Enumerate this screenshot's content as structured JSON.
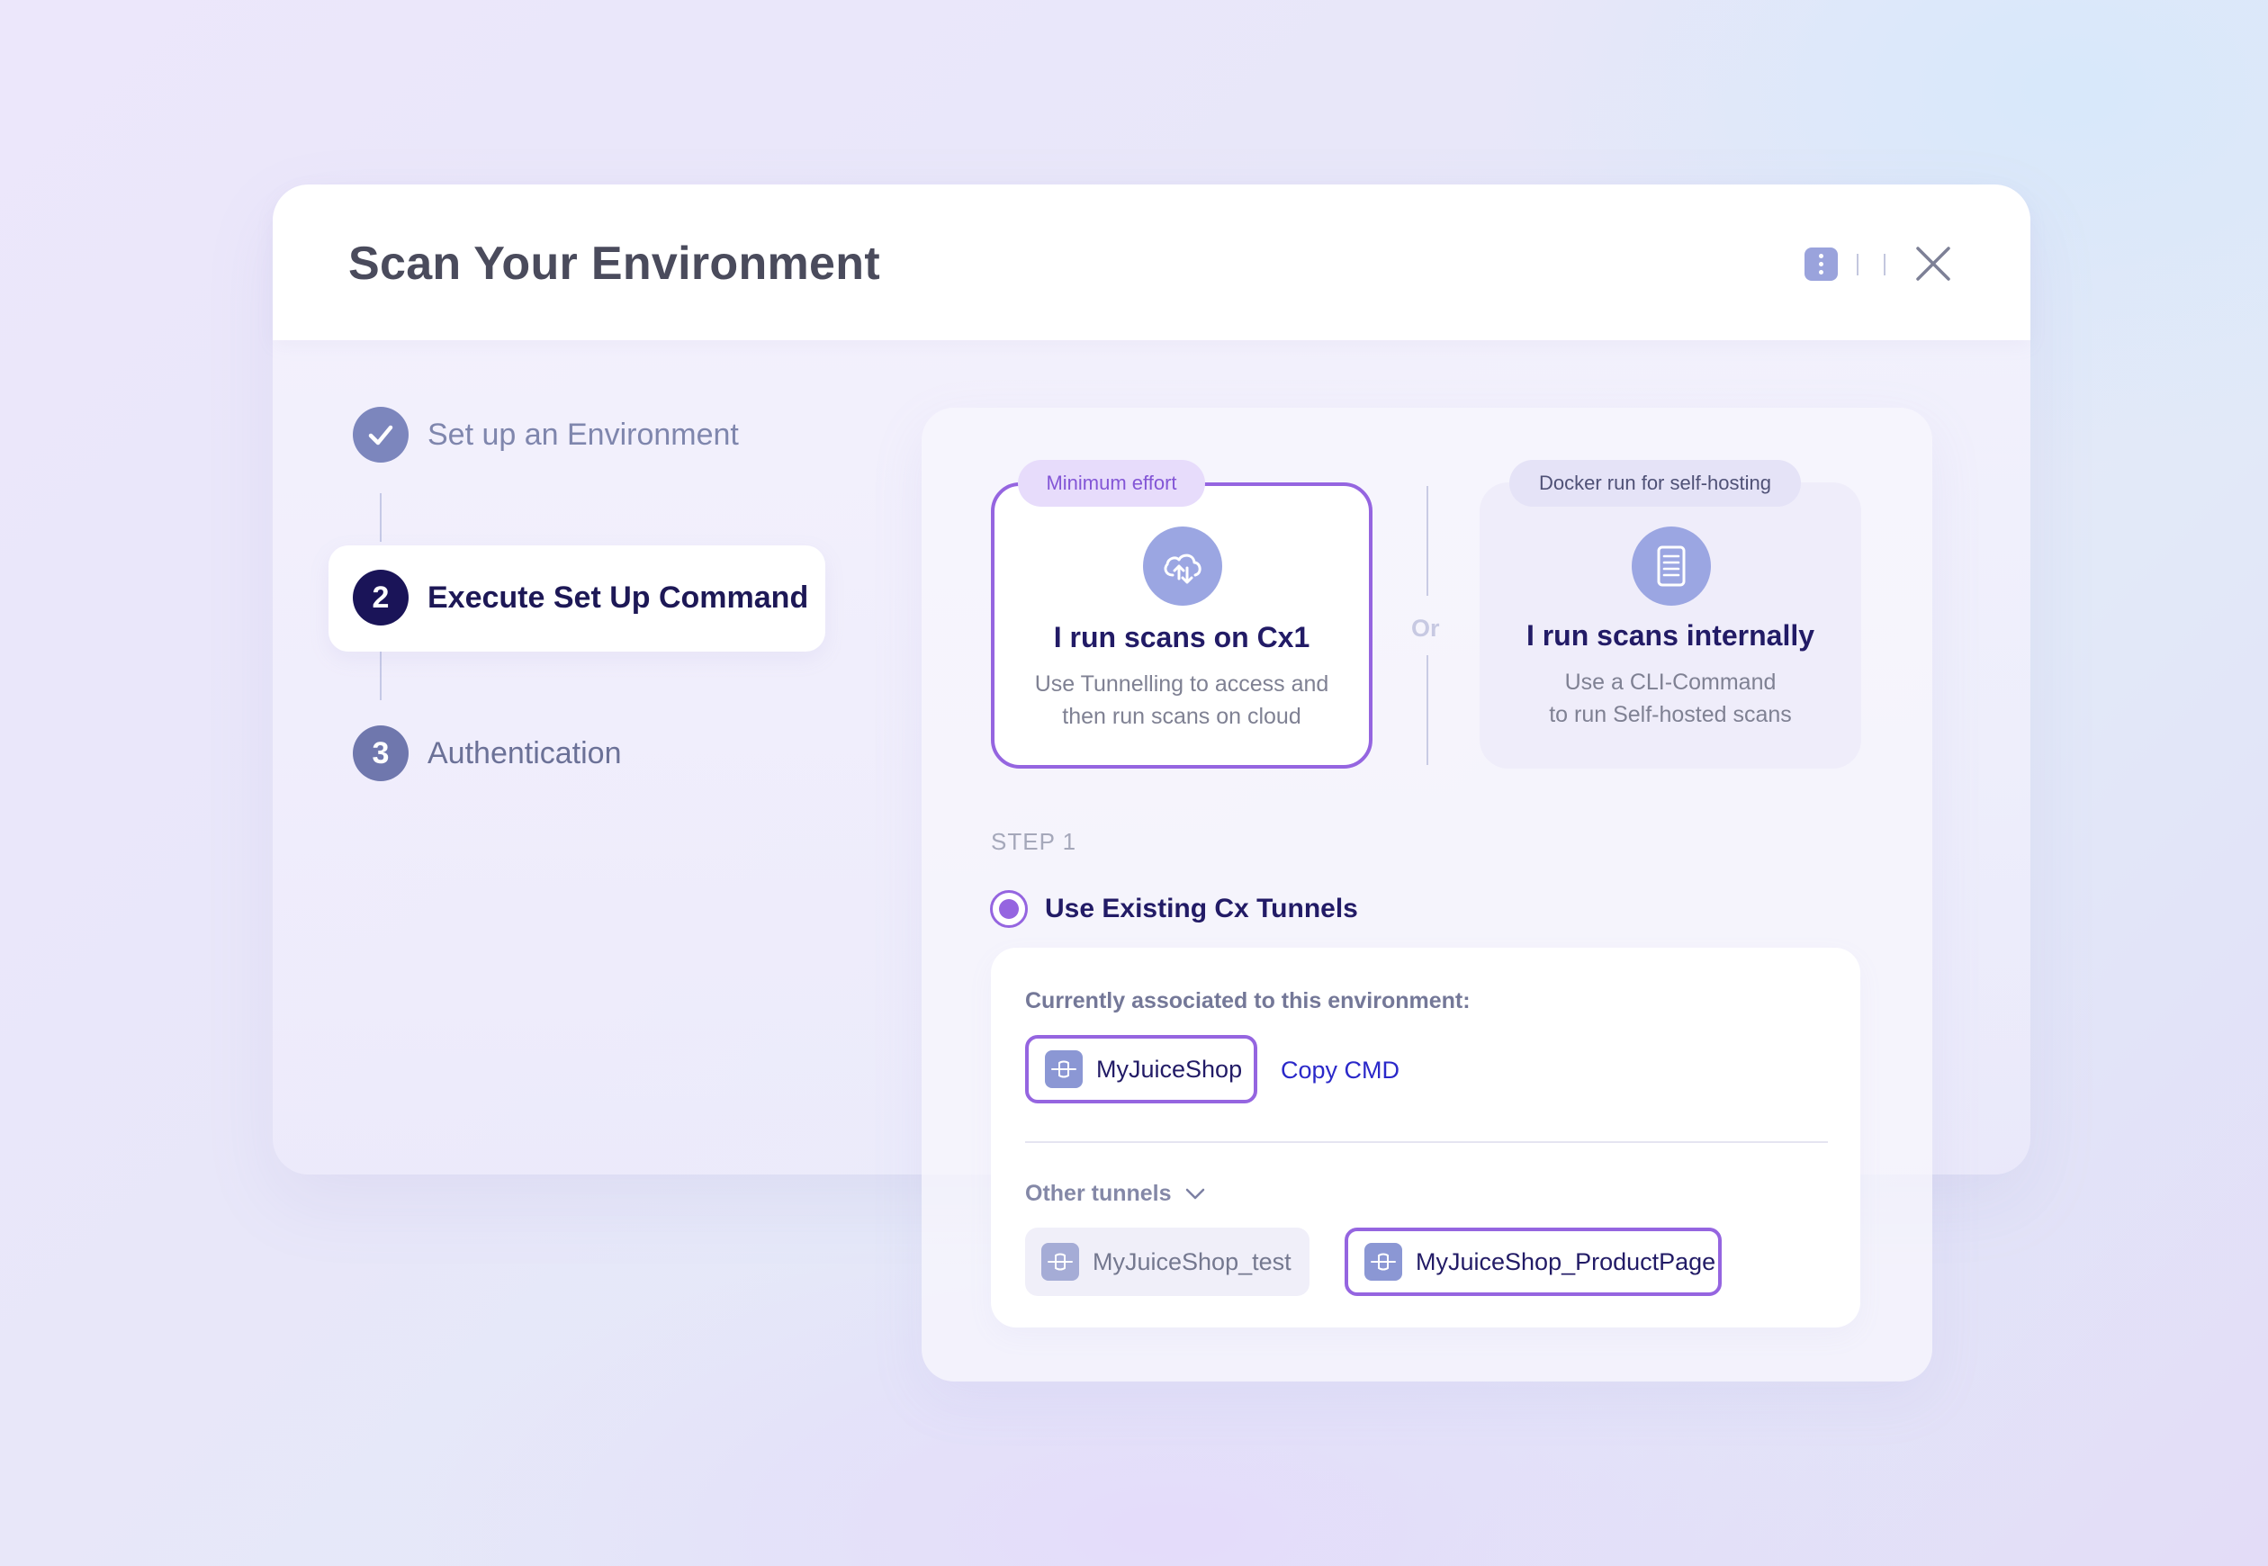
{
  "dialog": {
    "title": "Scan Your Environment"
  },
  "stepper": {
    "steps": [
      {
        "number": "",
        "label": "Set up an Environment",
        "state": "completed"
      },
      {
        "number": "2",
        "label": "Execute Set Up Command",
        "state": "active"
      },
      {
        "number": "3",
        "label": "Authentication",
        "state": "pending"
      }
    ]
  },
  "options": {
    "cloud": {
      "badge": "Minimum effort",
      "icon": "cloud-sync-icon",
      "title": "I run scans on Cx1",
      "desc_line1": "Use Tunnelling to access and",
      "desc_line2": "then run scans on cloud",
      "selected": true
    },
    "divider_text": "Or",
    "internal": {
      "badge": "Docker run for self-hosting",
      "icon": "server-icon",
      "title": "I run scans internally",
      "desc_line1": "Use a CLI-Command",
      "desc_line2": "to run Self-hosted scans",
      "selected": false
    }
  },
  "step_section": {
    "tag": "STEP 1",
    "radio_label": "Use Existing Cx Tunnels",
    "associated_label": "Currently associated to this environment:",
    "associated_tunnel": "MyJuiceShop",
    "copy_cmd": "Copy CMD",
    "other_label": "Other tunnels",
    "other_tunnels": [
      "MyJuiceShop_test",
      "MyJuiceShop_ProductPage"
    ]
  },
  "colors": {
    "accent": "#9565e0",
    "primary_text": "#221b66",
    "link": "#2a28c9"
  }
}
